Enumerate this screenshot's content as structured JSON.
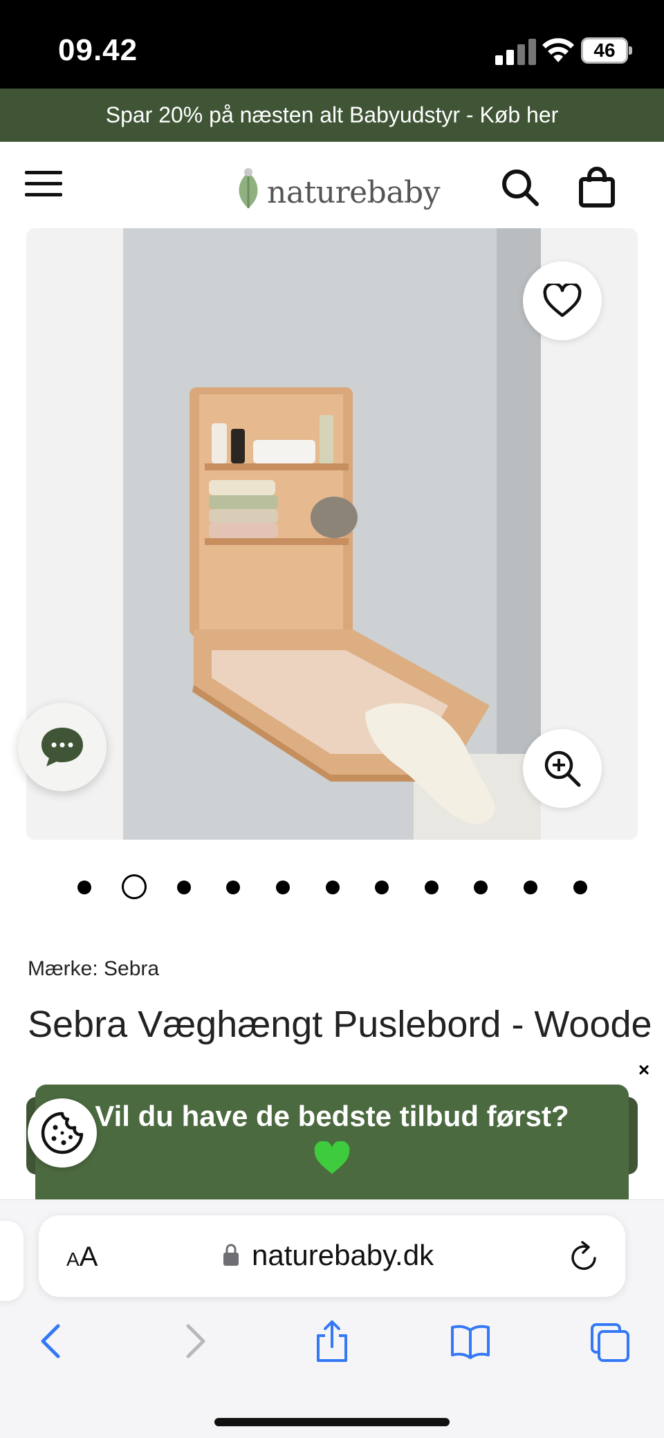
{
  "status_bar": {
    "time": "09.42",
    "battery": "46"
  },
  "promo_bar": {
    "text": "Spar 20% på næsten alt Babyudstyr - Køb her"
  },
  "header": {
    "logo_text": "naturebaby"
  },
  "gallery": {
    "image_count": 11,
    "active_index": 1
  },
  "product": {
    "brand_line": "Mærke: Sebra",
    "title": "Sebra Væghængt Puslebord - Wooden Edition"
  },
  "newsletter_popup": {
    "message": "Vil du have de bedste tilbud først?",
    "close_label": "×"
  },
  "safari": {
    "aa_small": "A",
    "aa_large": "A",
    "domain": "naturebaby.dk"
  },
  "colors": {
    "brand_green": "#3f5535",
    "popup_green": "#4b6a3f",
    "ios_blue": "#3478f6"
  }
}
